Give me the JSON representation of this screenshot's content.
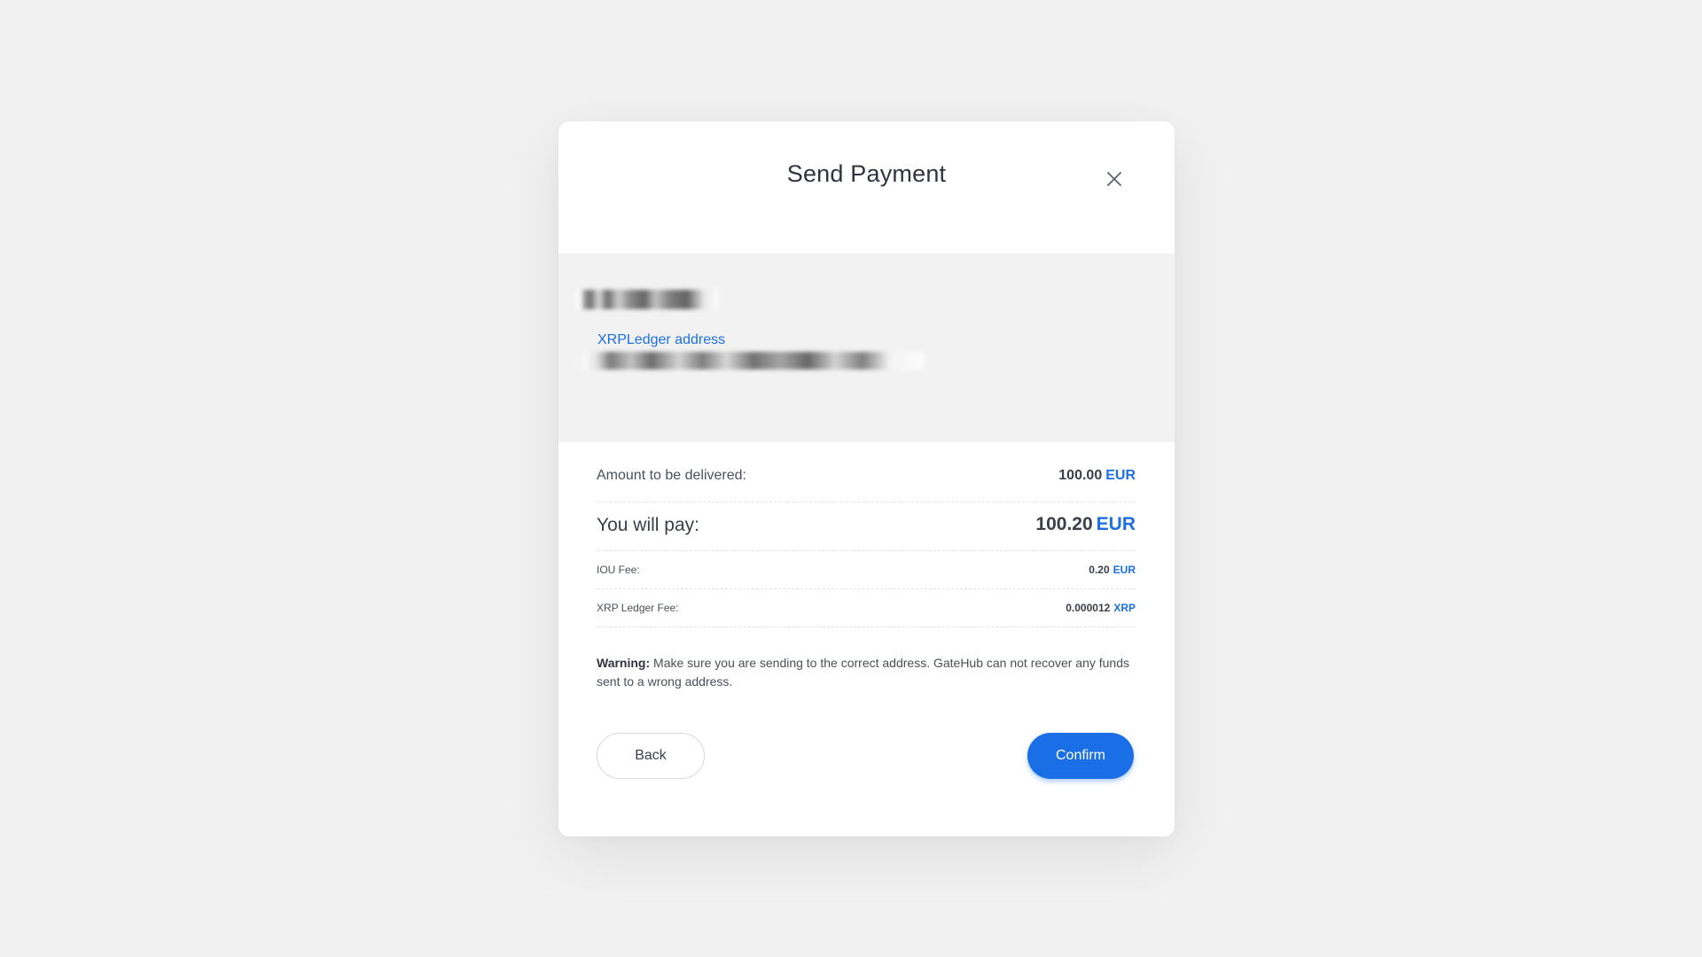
{
  "modal": {
    "title": "Send Payment"
  },
  "recipient": {
    "address_label": "XRPLedger address"
  },
  "details": {
    "amount_delivered": {
      "label": "Amount to be delivered:",
      "value": "100.00",
      "currency": "EUR"
    },
    "you_will_pay": {
      "label": "You will pay:",
      "value": "100.20",
      "currency": "EUR"
    },
    "iou_fee": {
      "label": "IOU Fee:",
      "value": "0.20",
      "currency": "EUR"
    },
    "xrp_ledger_fee": {
      "label": "XRP Ledger Fee:",
      "value": "0.000012",
      "currency": "XRP"
    }
  },
  "warning": {
    "title": "Warning:",
    "text": "Make sure you are sending to the correct address. GateHub can not recover any funds sent to a wrong address."
  },
  "buttons": {
    "back_label": "Back",
    "confirm_label": "Confirm"
  },
  "colors": {
    "accent": "#1a6fe6",
    "link": "#1c6fe3",
    "background": "#f1f1f1"
  },
  "icons": {
    "close": "close-icon"
  }
}
